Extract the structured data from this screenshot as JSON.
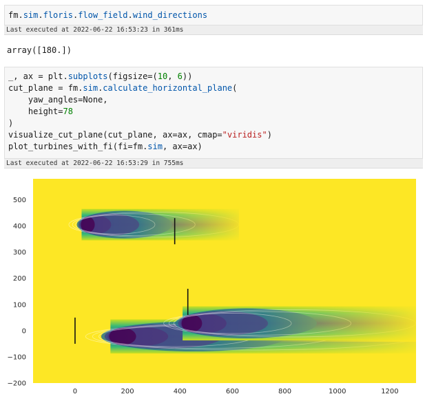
{
  "cells": [
    {
      "code_lines": [
        "fm.sim.floris.flow_field.wind_directions"
      ],
      "exec_status": "Last executed at 2022-06-22 16:53:23 in 361ms",
      "output": "array([180.])"
    },
    {
      "code_lines": [
        "_, ax = plt.subplots(figsize=(10, 6))",
        "cut_plane = fm.sim.calculate_horizontal_plane(",
        "    yaw_angles=None,",
        "    height=78",
        ")",
        "visualize_cut_plane(cut_plane, ax=ax, cmap=\"viridis\")",
        "plot_turbines_with_fi(fi=fm.sim, ax=ax)"
      ],
      "exec_status": "Last executed at 2022-06-22 16:53:29 in 755ms"
    }
  ],
  "colors": {
    "free_stream": "#fde725",
    "wake_deficit": "#31688e",
    "wake_center": "#440154",
    "turbine": "#111111"
  },
  "chart_data": {
    "type": "heatmap",
    "title": "",
    "xlabel": "",
    "ylabel": "",
    "colormap": "viridis",
    "xlim": [
      -160,
      1300
    ],
    "ylim": [
      -200,
      580
    ],
    "x_ticks": [
      0,
      200,
      400,
      600,
      800,
      1000,
      1200
    ],
    "y_ticks": [
      -200,
      -100,
      0,
      100,
      200,
      300,
      400,
      500
    ],
    "grid": false,
    "turbines": [
      {
        "x": 0,
        "y": 0,
        "rotor_diameter": 100
      },
      {
        "x": 380,
        "y": 380,
        "rotor_diameter": 100
      },
      {
        "x": 430,
        "y": 110,
        "rotor_diameter": 100
      }
    ],
    "wakes": [
      {
        "x_start": 25,
        "y": 405,
        "width": 120,
        "length": 600
      },
      {
        "x_start": 135,
        "y": -22,
        "width": 130,
        "length": 1170
      },
      {
        "x_start": 410,
        "y": 28,
        "width": 130,
        "length": 890
      }
    ]
  }
}
